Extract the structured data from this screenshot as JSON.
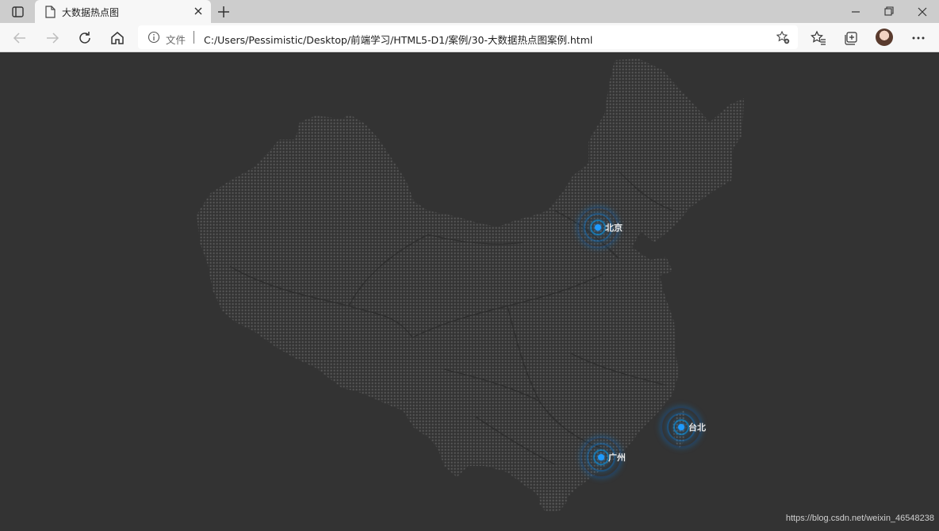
{
  "tab": {
    "title": "大数据热点图"
  },
  "toolbar": {
    "file_label": "文件",
    "url": "C:/Users/Pessimistic/Desktop/前端学习/HTML5-D1/案例/30-大数据热点图案例.html"
  },
  "map": {
    "background": "#333333",
    "dot_color": "#5a5a5a",
    "accent": "#1e9bff",
    "cities": [
      {
        "name": "北京"
      },
      {
        "name": "台北"
      },
      {
        "name": "广州"
      }
    ]
  },
  "watermark": "https://blog.csdn.net/weixin_46548238"
}
